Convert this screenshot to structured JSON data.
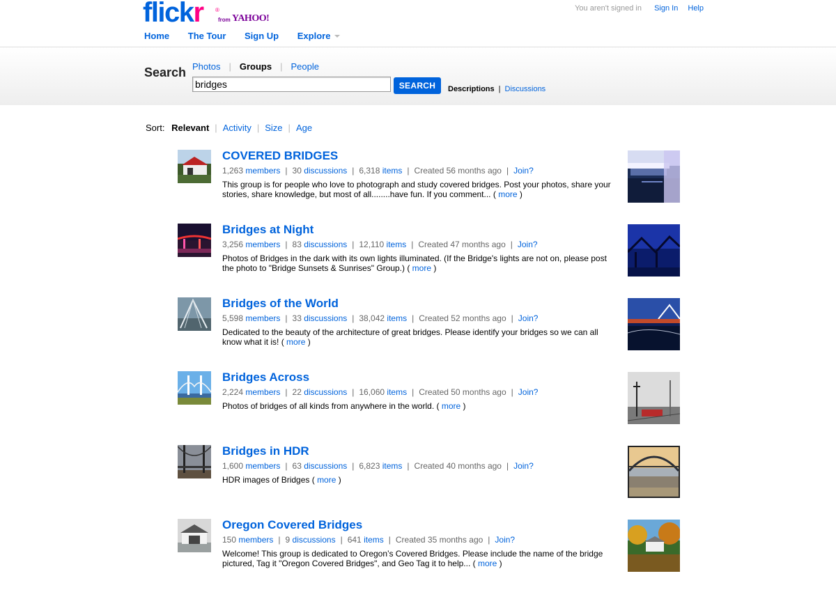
{
  "logo": {
    "part1": "flick",
    "part2": "r",
    "reg": "®",
    "from": "from",
    "yahoo": "YAHOO!"
  },
  "topbar": {
    "status": "You aren't signed in",
    "signin": "Sign In",
    "help": "Help"
  },
  "nav": [
    "Home",
    "The Tour",
    "Sign Up",
    "Explore"
  ],
  "search": {
    "title": "Search",
    "tabs": [
      "Photos",
      "Groups",
      "People"
    ],
    "active_tab": "Groups",
    "query": "bridges",
    "button": "SEARCH",
    "opt_current": "Descriptions",
    "opt_other": "Discussions"
  },
  "sort": {
    "label": "Sort:",
    "current": "Relevant",
    "options": [
      "Activity",
      "Size",
      "Age"
    ]
  },
  "results": [
    {
      "title": "COVERED BRIDGES",
      "members_num": "1,263",
      "members_label": "members",
      "discussions_num": "30",
      "discussions_label": "discussions",
      "items_num": "6,318",
      "items_label": "items",
      "created": "Created 56 months ago",
      "join": "Join?",
      "desc": "This group is for people who love to photograph and study covered bridges. Post your photos, share your stories, share knowledge, but most of all........have fun. If you comment... (",
      "more": "more",
      "close": ")"
    },
    {
      "title": "Bridges at Night",
      "members_num": "3,256",
      "members_label": "members",
      "discussions_num": "83",
      "discussions_label": "discussions",
      "items_num": "12,110",
      "items_label": "items",
      "created": "Created 47 months ago",
      "join": "Join?",
      "desc": "Photos of Bridges in the dark with its own lights illuminated. (If the Bridge's lights are not on, please post the photo to \"Bridge Sunsets & Sunrises\" Group.) (",
      "more": "more",
      "close": ")"
    },
    {
      "title": "Bridges of the World",
      "members_num": "5,598",
      "members_label": "members",
      "discussions_num": "33",
      "discussions_label": "discussions",
      "items_num": "38,042",
      "items_label": "items",
      "created": "Created 52 months ago",
      "join": "Join?",
      "desc": "Dedicated to the beauty of the architecture of great bridges. Please identify your bridges so we can all know what it is! (",
      "more": "more",
      "close": ")"
    },
    {
      "title": "Bridges Across",
      "members_num": "2,224",
      "members_label": "members",
      "discussions_num": "22",
      "discussions_label": "discussions",
      "items_num": "16,060",
      "items_label": "items",
      "created": "Created 50 months ago",
      "join": "Join?",
      "desc": "Photos of bridges of all kinds from anywhere in the world. (",
      "more": "more",
      "close": ")"
    },
    {
      "title": "Bridges in HDR",
      "members_num": "1,600",
      "members_label": "members",
      "discussions_num": "63",
      "discussions_label": "discussions",
      "items_num": "6,823",
      "items_label": "items",
      "created": "Created 40 months ago",
      "join": "Join?",
      "desc": "HDR images of Bridges (",
      "more": "more",
      "close": ")"
    },
    {
      "title": "Oregon Covered Bridges",
      "members_num": "150",
      "members_label": "members",
      "discussions_num": "9",
      "discussions_label": "discussions",
      "items_num": "641",
      "items_label": "items",
      "created": "Created 35 months ago",
      "join": "Join?",
      "desc": "Welcome! This group is dedicated to Oregon’s Covered Bridges. Please include the name of the bridge pictured, Tag it \"Oregon Covered Bridges\", and Geo Tag it to help... (",
      "more": "more",
      "close": ")"
    }
  ],
  "colors": {
    "link": "#0063dc",
    "brand_pink": "#ff0084",
    "yahoo_purple": "#7b0099"
  }
}
